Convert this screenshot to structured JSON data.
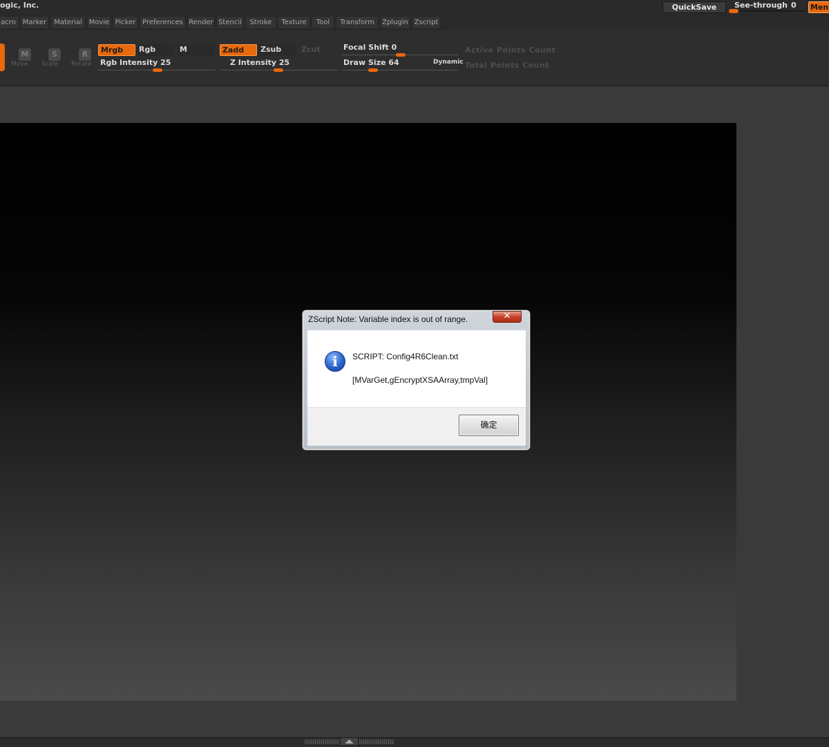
{
  "titlebar": {
    "title": "ogic, Inc.",
    "quicksave_label": "QuickSave",
    "seethrough_label": "See-through",
    "seethrough_value": "0",
    "menus_label": "Menus"
  },
  "menus": [
    "acro",
    "Marker",
    "Material",
    "Movie",
    "Picker",
    "Preferences",
    "Render",
    "Stencil",
    "Stroke",
    "Texture",
    "Tool",
    "Transform",
    "Zplugin",
    "Zscript"
  ],
  "toolbar": {
    "transform_tools": [
      {
        "letter": "M",
        "label": "Move"
      },
      {
        "letter": "S",
        "label": "Scale"
      },
      {
        "letter": "R",
        "label": "Rotate"
      }
    ],
    "mrgb": "Mrgb",
    "rgb": "Rgb",
    "m": "M",
    "zadd": "Zadd",
    "zsub": "Zsub",
    "zcut": "Zcut",
    "rgb_intensity_label": "Rgb Intensity 25",
    "z_intensity_label": "Z Intensity 25",
    "focal_shift_label": "Focal Shift 0",
    "draw_size_label": "Draw Size 64",
    "dynamic_label": "Dynamic",
    "active_points_label": "Active Points Count",
    "total_points_label": "Total Points Count",
    "accent_color": "#e8680c"
  },
  "dialog": {
    "title": "ZScript Note: Variable index is out of range.",
    "close_symbol": "✕",
    "icon": "info-icon",
    "icon_glyph": "i",
    "script_line": "SCRIPT: Config4R6Clean.txt",
    "detail_line": "[MVarGet,gEncryptXSAArray,tmpVal]",
    "ok_label": "确定"
  },
  "bottom": {
    "arrows": "◢◣"
  }
}
